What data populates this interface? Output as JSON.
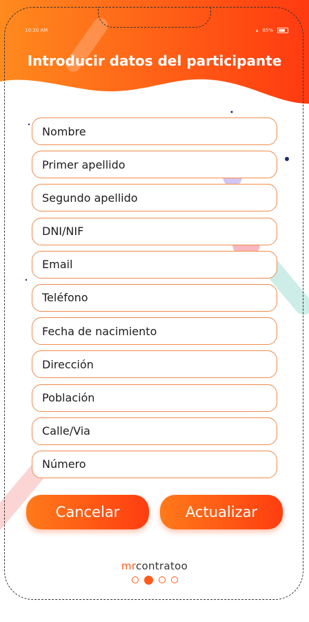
{
  "status_bar": {
    "time": "10:30 AM",
    "battery": "85%"
  },
  "header": {
    "title": "Introducir datos del participante"
  },
  "form": {
    "fields": [
      {
        "placeholder": "Nombre"
      },
      {
        "placeholder": "Primer apellido"
      },
      {
        "placeholder": "Segundo apellido"
      },
      {
        "placeholder": "DNI/NIF"
      },
      {
        "placeholder": "Email"
      },
      {
        "placeholder": "Teléfono"
      },
      {
        "placeholder": "Fecha de nacimiento"
      },
      {
        "placeholder": "Dirección"
      },
      {
        "placeholder": "Población"
      },
      {
        "placeholder": "Calle/Via"
      },
      {
        "placeholder": "Número"
      }
    ]
  },
  "actions": {
    "cancel_label": "Cancelar",
    "update_label": "Actualizar"
  },
  "brand": {
    "logo_prefix": "mr",
    "logo_suffix": "contratoo"
  },
  "pager": {
    "pages": 4,
    "active_index": 1
  },
  "colors": {
    "accent": "#ff5a1a",
    "accent_dark": "#ff3d10",
    "field_border": "#f08a4b"
  }
}
